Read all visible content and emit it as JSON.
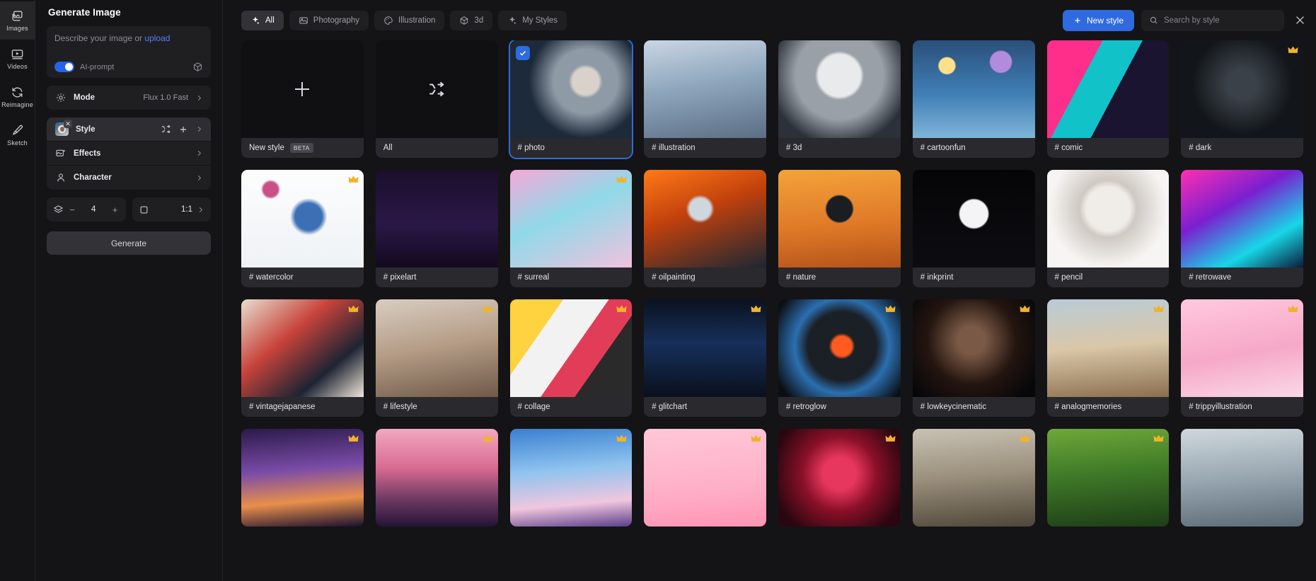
{
  "rail": {
    "items": [
      {
        "label": "Images",
        "icon": "images-icon",
        "active": true
      },
      {
        "label": "Videos",
        "icon": "video-icon",
        "active": false
      },
      {
        "label": "Reimagine",
        "icon": "refresh-icon",
        "active": false
      },
      {
        "label": "Sketch",
        "icon": "brush-icon",
        "active": false
      }
    ]
  },
  "panel": {
    "title": "Generate Image",
    "prompt": {
      "placeholder_prefix": "Describe your image or ",
      "upload_link": "upload",
      "value": "",
      "toggle_label": "AI-prompt",
      "toggle_on": true,
      "cube_icon": "cube-icon"
    },
    "options": [
      {
        "name": "mode",
        "icon": "chip-icon",
        "label": "Mode",
        "value": "Flux 1.0 Fast"
      },
      {
        "name": "style",
        "icon": "style-thumbnail",
        "label": "Style",
        "value": ""
      },
      {
        "name": "effects",
        "icon": "effects-icon",
        "label": "Effects",
        "value": ""
      },
      {
        "name": "character",
        "icon": "person-icon",
        "label": "Character",
        "value": ""
      }
    ],
    "count_stepper": {
      "icon": "layers-icon",
      "minus": "−",
      "value": "4",
      "plus": "+"
    },
    "ratio_stepper": {
      "icon": "square-icon",
      "value": "1:1"
    },
    "generate_label": "Generate"
  },
  "header": {
    "tabs": [
      {
        "label": "All",
        "icon": "sparkle-icon",
        "active": true
      },
      {
        "label": "Photography",
        "icon": "photo-icon",
        "active": false
      },
      {
        "label": "Illustration",
        "icon": "palette-icon",
        "active": false
      },
      {
        "label": "3d",
        "icon": "cube-icon",
        "active": false
      },
      {
        "label": "My Styles",
        "icon": "sparkle-icon",
        "active": false
      }
    ],
    "new_style_label": "New style",
    "new_style_icon": "plus-icon",
    "search": {
      "placeholder": "Search by style",
      "value": "",
      "icon": "search-icon"
    },
    "close_icon": "close-icon",
    "accent_color": "#2f6ae0"
  },
  "grid": {
    "cards": [
      {
        "label": "New style",
        "badge": "BETA",
        "kind": "new",
        "premium": false,
        "selected": false
      },
      {
        "label": "All",
        "badge": "",
        "kind": "all",
        "premium": false,
        "selected": false
      },
      {
        "label": "# photo",
        "badge": "",
        "kind": "art",
        "premium": false,
        "selected": true,
        "art": "photo"
      },
      {
        "label": "# illustration",
        "badge": "",
        "kind": "art",
        "premium": false,
        "selected": false,
        "art": "illustration"
      },
      {
        "label": "# 3d",
        "badge": "",
        "kind": "art",
        "premium": false,
        "selected": false,
        "art": "threed"
      },
      {
        "label": "# cartoonfun",
        "badge": "",
        "kind": "art",
        "premium": false,
        "selected": false,
        "art": "cartoonfun"
      },
      {
        "label": "# comic",
        "badge": "",
        "kind": "art",
        "premium": false,
        "selected": false,
        "art": "comic"
      },
      {
        "label": "# dark",
        "badge": "",
        "kind": "art",
        "premium": true,
        "selected": false,
        "art": "dark"
      },
      {
        "label": "# watercolor",
        "badge": "",
        "kind": "art",
        "premium": true,
        "selected": false,
        "art": "watercolor"
      },
      {
        "label": "# pixelart",
        "badge": "",
        "kind": "art",
        "premium": false,
        "selected": false,
        "art": "pixelart"
      },
      {
        "label": "# surreal",
        "badge": "",
        "kind": "art",
        "premium": true,
        "selected": false,
        "art": "surreal"
      },
      {
        "label": "# oilpainting",
        "badge": "",
        "kind": "art",
        "premium": false,
        "selected": false,
        "art": "oilpainting"
      },
      {
        "label": "# nature",
        "badge": "",
        "kind": "art",
        "premium": false,
        "selected": false,
        "art": "nature"
      },
      {
        "label": "# inkprint",
        "badge": "",
        "kind": "art",
        "premium": false,
        "selected": false,
        "art": "inkprint"
      },
      {
        "label": "# pencil",
        "badge": "",
        "kind": "art",
        "premium": false,
        "selected": false,
        "art": "pencil"
      },
      {
        "label": "# retrowave",
        "badge": "",
        "kind": "art",
        "premium": false,
        "selected": false,
        "art": "retrowave"
      },
      {
        "label": "# vintagejapanese",
        "badge": "",
        "kind": "art",
        "premium": true,
        "selected": false,
        "art": "vintagejapanese"
      },
      {
        "label": "# lifestyle",
        "badge": "",
        "kind": "art",
        "premium": true,
        "selected": false,
        "art": "lifestyle"
      },
      {
        "label": "# collage",
        "badge": "",
        "kind": "art",
        "premium": true,
        "selected": false,
        "art": "collage"
      },
      {
        "label": "# glitchart",
        "badge": "",
        "kind": "art",
        "premium": true,
        "selected": false,
        "art": "glitchart"
      },
      {
        "label": "# retroglow",
        "badge": "",
        "kind": "art",
        "premium": true,
        "selected": false,
        "art": "retroglow"
      },
      {
        "label": "# lowkeycinematic",
        "badge": "",
        "kind": "art",
        "premium": true,
        "selected": false,
        "art": "lowkeycinematic"
      },
      {
        "label": "# analogmemories",
        "badge": "",
        "kind": "art",
        "premium": true,
        "selected": false,
        "art": "analogmemories"
      },
      {
        "label": "# trippyillustration",
        "badge": "",
        "kind": "art",
        "premium": true,
        "selected": false,
        "art": "trippyillustration"
      },
      {
        "label": "",
        "badge": "",
        "kind": "art",
        "premium": true,
        "selected": false,
        "art": "r4a"
      },
      {
        "label": "",
        "badge": "",
        "kind": "art",
        "premium": true,
        "selected": false,
        "art": "r4b"
      },
      {
        "label": "",
        "badge": "",
        "kind": "art",
        "premium": true,
        "selected": false,
        "art": "r4c"
      },
      {
        "label": "",
        "badge": "",
        "kind": "art",
        "premium": true,
        "selected": false,
        "art": "r4d"
      },
      {
        "label": "",
        "badge": "",
        "kind": "art",
        "premium": true,
        "selected": false,
        "art": "r4e"
      },
      {
        "label": "",
        "badge": "",
        "kind": "art",
        "premium": true,
        "selected": false,
        "art": "r4f"
      },
      {
        "label": "",
        "badge": "",
        "kind": "art",
        "premium": true,
        "selected": false,
        "art": "r4g"
      },
      {
        "label": "",
        "badge": "",
        "kind": "art",
        "premium": false,
        "selected": false,
        "art": "r4h"
      }
    ]
  }
}
